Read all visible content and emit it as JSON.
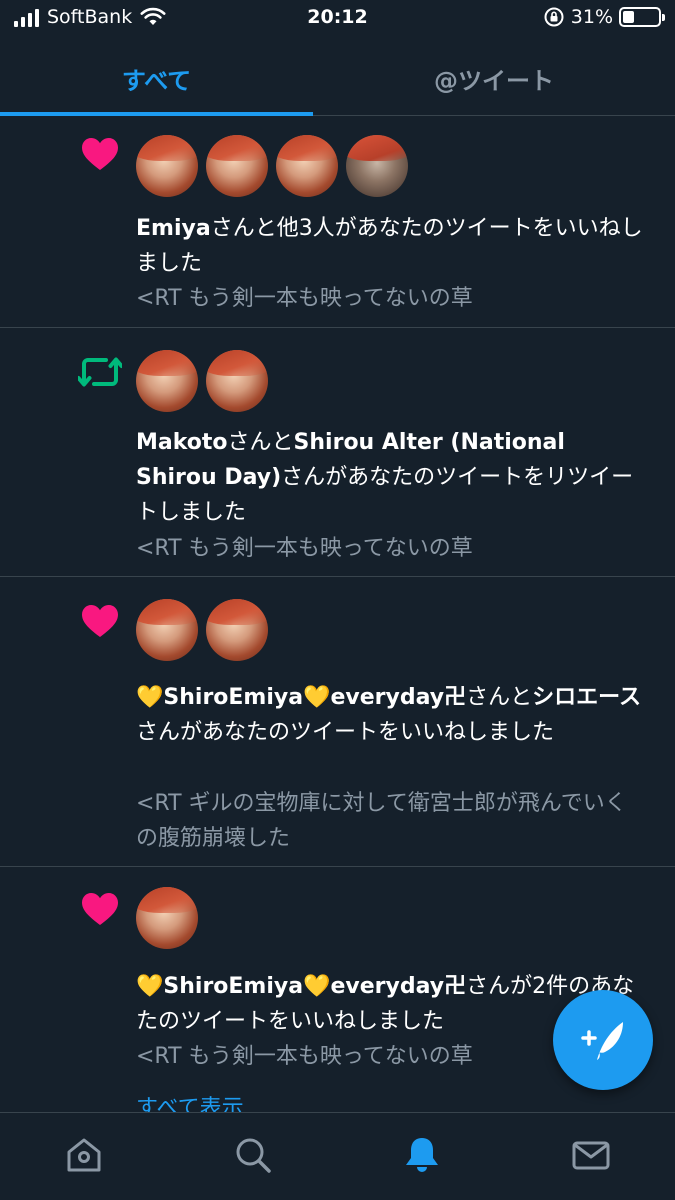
{
  "status_bar": {
    "carrier": "SoftBank",
    "time": "20:12",
    "battery": "31%",
    "battery_level": 0.31
  },
  "tabs": [
    {
      "label": "すべて",
      "active": true
    },
    {
      "label": "@ツイート",
      "active": false
    }
  ],
  "notifications": [
    {
      "type": "like",
      "icon": "heart-icon",
      "avatar_count": 4,
      "text_parts": [
        {
          "bold": true,
          "text": "Emiya"
        },
        {
          "bold": false,
          "text": "さんと他3人があなたのツイートをいいねしました"
        }
      ],
      "snippet": "<RT  もう剣一本も映ってないの草"
    },
    {
      "type": "retweet",
      "icon": "retweet-icon",
      "avatar_count": 2,
      "text_parts": [
        {
          "bold": true,
          "text": "Makoto"
        },
        {
          "bold": false,
          "text": "さんと"
        },
        {
          "bold": true,
          "text": "Shirou Alter (National Shirou Day)"
        },
        {
          "bold": false,
          "text": "さんがあなたのツイートをリツイートしました"
        }
      ],
      "snippet": "<RT  もう剣一本も映ってないの草"
    },
    {
      "type": "like",
      "icon": "heart-icon",
      "avatar_count": 2,
      "text_parts": [
        {
          "bold": true,
          "text": "💛ShiroEmiya💛everyday卍"
        },
        {
          "bold": false,
          "text": "さんと"
        },
        {
          "bold": true,
          "text": "シロエース"
        },
        {
          "bold": false,
          "text": "さんがあなたのツイートをいいねしました"
        }
      ],
      "snippet": "<RT  ギルの宝物庫に対して衛宮士郎が飛んでいくの腹筋崩壊した"
    },
    {
      "type": "like",
      "icon": "heart-icon",
      "avatar_count": 1,
      "text_parts": [
        {
          "bold": true,
          "text": "💛ShiroEmiya💛everyday卍"
        },
        {
          "bold": false,
          "text": "さんが2件のあなたのツイートをいいねしました"
        }
      ],
      "snippet": "<RT  もう剣一本も映ってないの草",
      "show_all": "すべて表示"
    }
  ],
  "bottom_nav": [
    {
      "name": "home-icon",
      "active": false
    },
    {
      "name": "search-icon",
      "active": false
    },
    {
      "name": "bell-icon",
      "active": true
    },
    {
      "name": "mail-icon",
      "active": false
    }
  ],
  "fab": {
    "icon": "compose-tweet-icon"
  },
  "colors": {
    "background": "#15202b",
    "accent": "#1d9bf0",
    "like": "#f91880",
    "retweet": "#00ba7c",
    "divider": "#38444d",
    "secondary_text": "#8b98a5"
  }
}
